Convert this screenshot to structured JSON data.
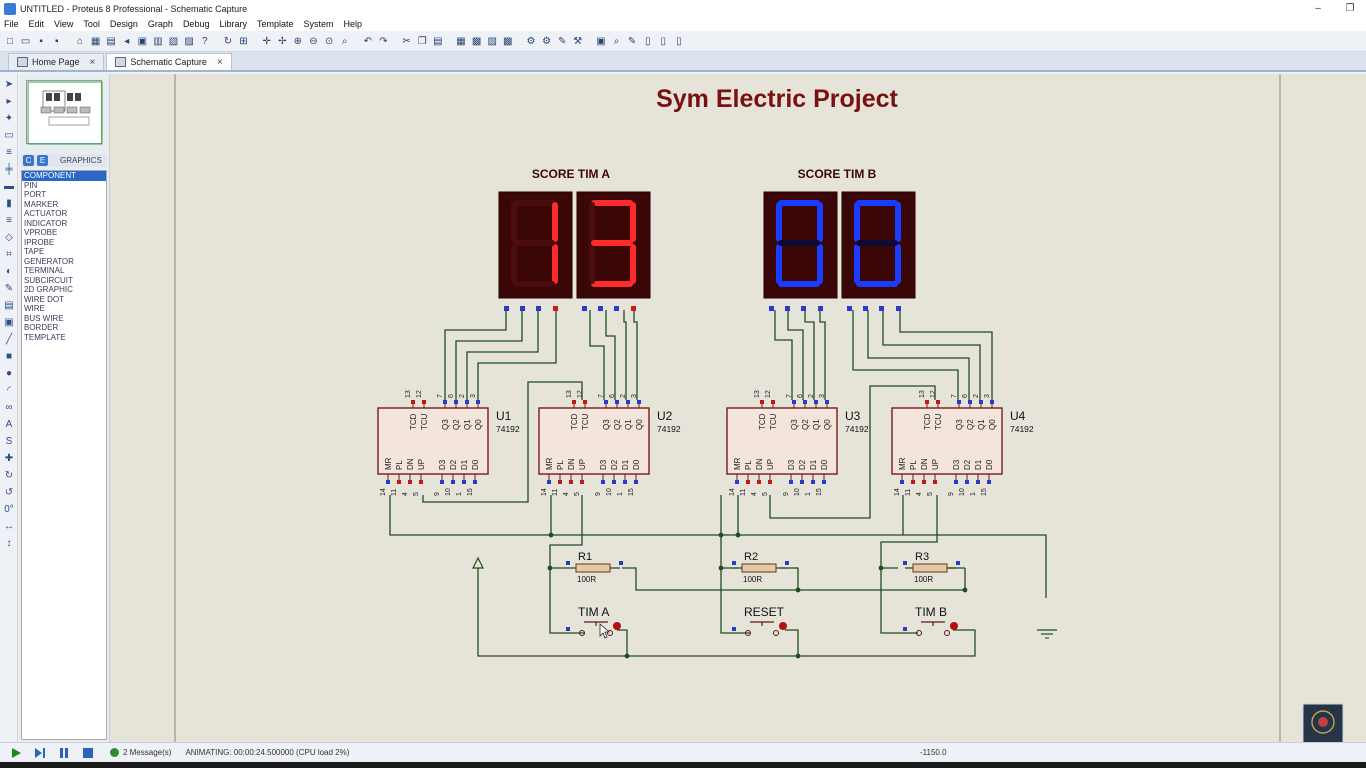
{
  "window": {
    "title": "UNTITLED - Proteus 8 Professional - Schematic Capture",
    "minimize": "–",
    "maximize": "❐"
  },
  "menu": [
    "File",
    "Edit",
    "View",
    "Tool",
    "Design",
    "Graph",
    "Debug",
    "Library",
    "Template",
    "System",
    "Help"
  ],
  "tabs": [
    {
      "label": "Home Page",
      "close": "×"
    },
    {
      "label": "Schematic Capture",
      "close": "×"
    }
  ],
  "panel": {
    "mode_icons": [
      "C",
      "E"
    ],
    "title": "GRAPHICS",
    "items": [
      "COMPONENT",
      "PIN",
      "PORT",
      "MARKER",
      "ACTUATOR",
      "INDICATOR",
      "VPROBE",
      "IPROBE",
      "TAPE",
      "GENERATOR",
      "TERMINAL",
      "SUBCIRCUIT",
      "2D GRAPHIC",
      "WIRE DOT",
      "WIRE",
      "BUS WIRE",
      "BORDER",
      "TEMPLATE"
    ],
    "selected": "COMPONENT",
    "rotation_value": "0°"
  },
  "schematic": {
    "title": "Sym Electric Project",
    "score_a_label": "SCORE TIM A",
    "score_b_label": "SCORE TIM B",
    "display_a_digit1": "1",
    "display_a_digit2": "3",
    "display_b_digit1": "0",
    "display_b_digit2": "0",
    "counters": [
      {
        "ref": "U1",
        "part": "74192"
      },
      {
        "ref": "U2",
        "part": "74192"
      },
      {
        "ref": "U3",
        "part": "74192"
      },
      {
        "ref": "U4",
        "part": "74192"
      }
    ],
    "counter_top_pins": [
      "TCD",
      "TCU",
      "Q3",
      "Q2",
      "Q1",
      "Q0"
    ],
    "counter_bottom_pins": [
      "MR",
      "PL",
      "DN",
      "UP",
      "D3",
      "D2",
      "D1",
      "D0"
    ],
    "counter_top_nums": [
      "13",
      "12",
      "7",
      "6",
      "2",
      "3"
    ],
    "counter_bottom_nums": [
      "14",
      "11",
      "4",
      "5",
      "9",
      "10",
      "1",
      "15"
    ],
    "resistors": [
      {
        "ref": "R1",
        "value": "100R"
      },
      {
        "ref": "R2",
        "value": "100R"
      },
      {
        "ref": "R3",
        "value": "100R"
      }
    ],
    "buttons": [
      "TIM A",
      "RESET",
      "TIM B"
    ],
    "colors": {
      "wire": "#1f4d1f",
      "title": "#7a1010",
      "ic_fill": "#f3e4dc",
      "ic_border": "#7a1a1a",
      "seg_red": "#ff2a2a",
      "seg_blue": "#1a3cff",
      "seg_off": "#4a0c0c",
      "seg_off_b": "#0e0a33"
    }
  },
  "status": {
    "messages": "2 Message(s)",
    "animating": "ANIMATING: 00:00:24.500000 (CPU load 2%)",
    "coordinate": "-1150.0"
  }
}
